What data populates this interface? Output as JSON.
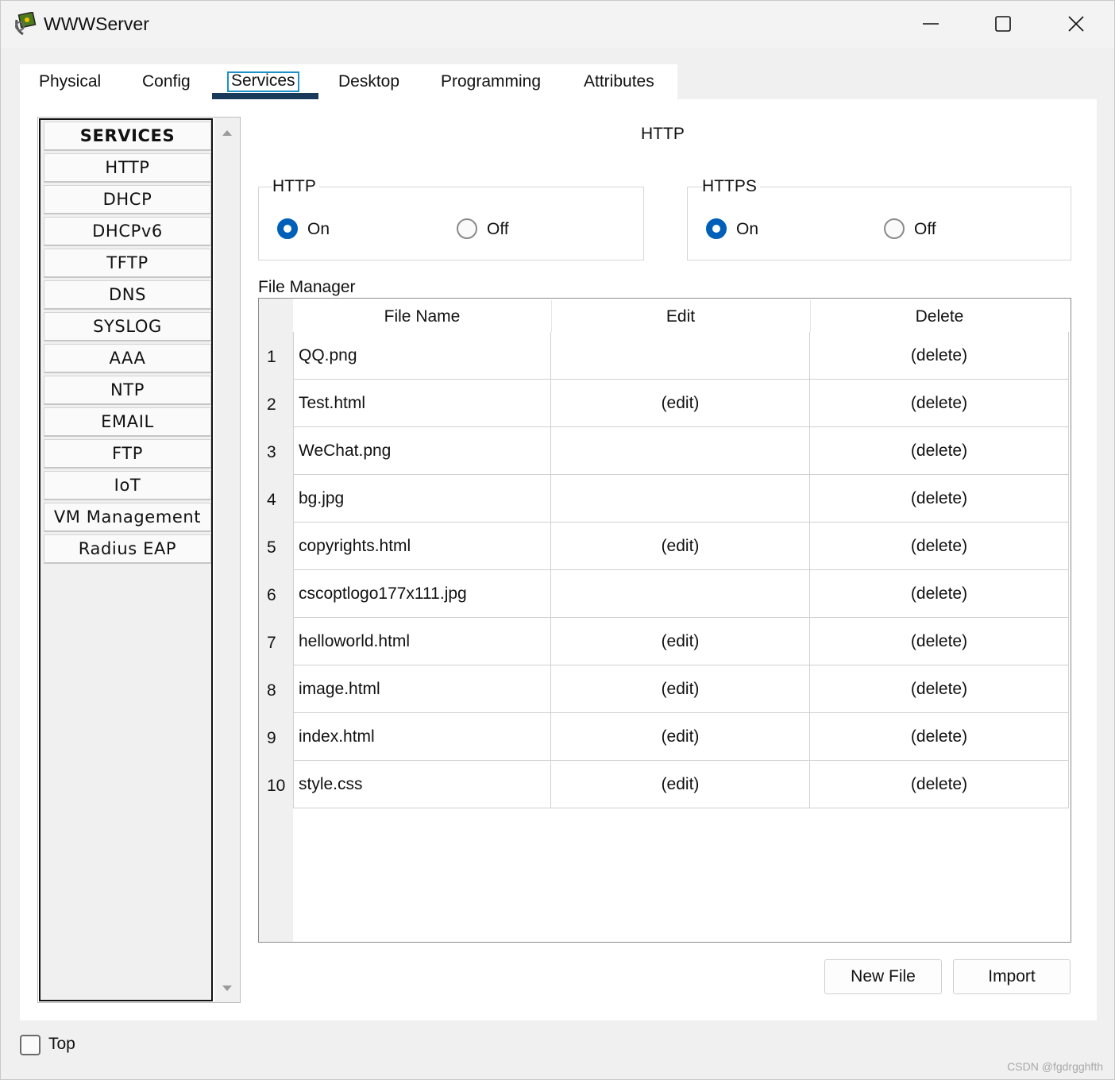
{
  "window": {
    "title": "WWWServer",
    "icon": "cisco-server-icon"
  },
  "tabs": [
    {
      "label": "Physical"
    },
    {
      "label": "Config"
    },
    {
      "label": "Services",
      "selected": true
    },
    {
      "label": "Desktop"
    },
    {
      "label": "Programming"
    },
    {
      "label": "Attributes"
    }
  ],
  "services": {
    "header": "SERVICES",
    "items": [
      "HTTP",
      "DHCP",
      "DHCPv6",
      "TFTP",
      "DNS",
      "SYSLOG",
      "AAA",
      "NTP",
      "EMAIL",
      "FTP",
      "IoT",
      "VM Management",
      "Radius EAP"
    ]
  },
  "panel": {
    "title": "HTTP",
    "http": {
      "legend": "HTTP",
      "on_label": "On",
      "off_label": "Off",
      "selected": "On"
    },
    "https": {
      "legend": "HTTPS",
      "on_label": "On",
      "off_label": "Off",
      "selected": "On"
    }
  },
  "file_manager": {
    "label": "File Manager",
    "columns": [
      "File Name",
      "Edit",
      "Delete"
    ],
    "rows": [
      {
        "num": "1",
        "name": "QQ.png",
        "edit": "",
        "delete": "(delete)"
      },
      {
        "num": "2",
        "name": "Test.html",
        "edit": "(edit)",
        "delete": "(delete)"
      },
      {
        "num": "3",
        "name": "WeChat.png",
        "edit": "",
        "delete": "(delete)"
      },
      {
        "num": "4",
        "name": "bg.jpg",
        "edit": "",
        "delete": "(delete)"
      },
      {
        "num": "5",
        "name": "copyrights.html",
        "edit": "(edit)",
        "delete": "(delete)"
      },
      {
        "num": "6",
        "name": "cscoptlogo177x111.jpg",
        "edit": "",
        "delete": "(delete)"
      },
      {
        "num": "7",
        "name": "helloworld.html",
        "edit": "(edit)",
        "delete": "(delete)"
      },
      {
        "num": "8",
        "name": "image.html",
        "edit": "(edit)",
        "delete": "(delete)"
      },
      {
        "num": "9",
        "name": "index.html",
        "edit": "(edit)",
        "delete": "(delete)"
      },
      {
        "num": "10",
        "name": "style.css",
        "edit": "(edit)",
        "delete": "(delete)"
      }
    ],
    "new_file_label": "New File",
    "import_label": "Import"
  },
  "footer": {
    "top_label": "Top",
    "top_checked": false
  },
  "watermark": "CSDN @fgdrgghfth",
  "colors": {
    "accent": "#005fb8",
    "tab_underline": "#1a3a5c",
    "tab_focus": "#1e90c8"
  }
}
